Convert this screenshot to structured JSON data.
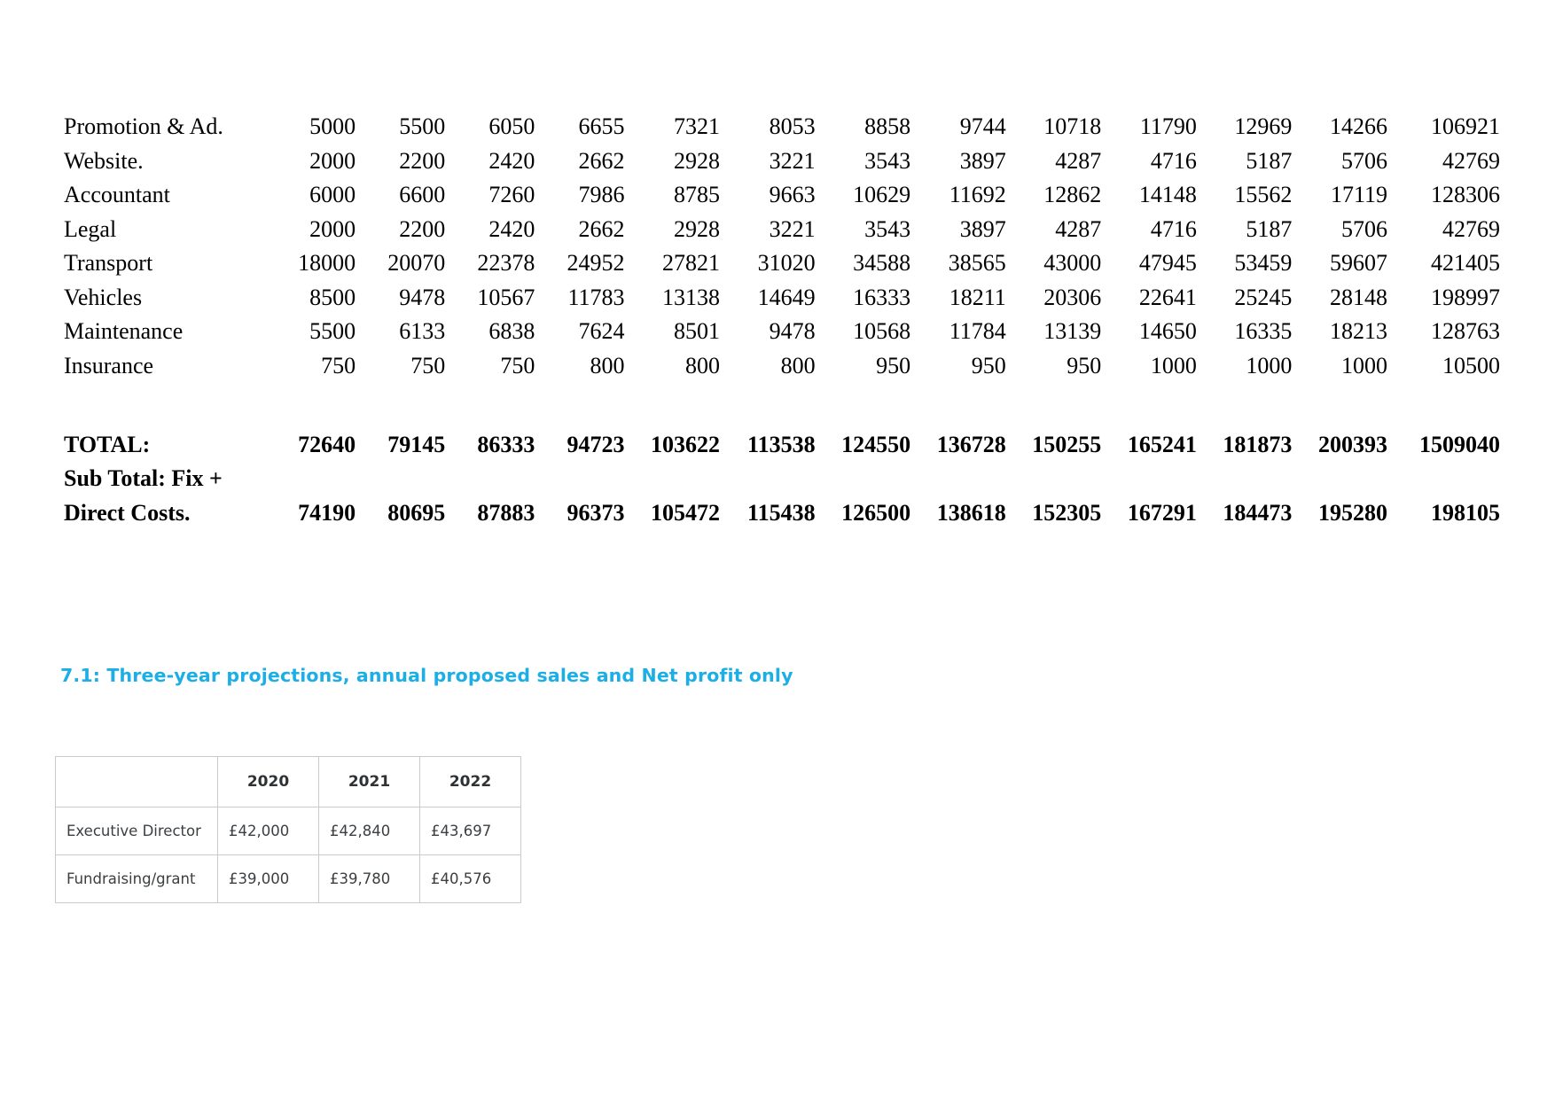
{
  "cost_table": {
    "rows": [
      {
        "label": "Promotion & Ad.",
        "values": [
          "5000",
          "5500",
          "6050",
          "6655",
          "7321",
          "8053",
          "8858",
          "9744",
          "10718",
          "11790",
          "12969",
          "14266",
          "106921"
        ]
      },
      {
        "label": "Website.",
        "values": [
          "2000",
          "2200",
          "2420",
          "2662",
          "2928",
          "3221",
          "3543",
          "3897",
          "4287",
          "4716",
          "5187",
          "5706",
          "42769"
        ]
      },
      {
        "label": "Accountant",
        "values": [
          "6000",
          "6600",
          "7260",
          "7986",
          "8785",
          "9663",
          "10629",
          "11692",
          "12862",
          "14148",
          "15562",
          "17119",
          "128306"
        ]
      },
      {
        "label": "Legal",
        "values": [
          "2000",
          "2200",
          "2420",
          "2662",
          "2928",
          "3221",
          "3543",
          "3897",
          "4287",
          "4716",
          "5187",
          "5706",
          "42769"
        ]
      },
      {
        "label": "Transport",
        "values": [
          "18000",
          "20070",
          "22378",
          "24952",
          "27821",
          "31020",
          "34588",
          "38565",
          "43000",
          "47945",
          "53459",
          "59607",
          "421405"
        ]
      },
      {
        "label": "Vehicles",
        "values": [
          "8500",
          "9478",
          "10567",
          "11783",
          "13138",
          "14649",
          "16333",
          "18211",
          "20306",
          "22641",
          "25245",
          "28148",
          "198997"
        ]
      },
      {
        "label": "Maintenance",
        "values": [
          "5500",
          "6133",
          "6838",
          "7624",
          "8501",
          "9478",
          "10568",
          "11784",
          "13139",
          "14650",
          "16335",
          "18213",
          "128763"
        ]
      },
      {
        "label": "Insurance",
        "values": [
          "750",
          "750",
          "750",
          "800",
          "800",
          "800",
          "950",
          "950",
          "950",
          "1000",
          "1000",
          "1000",
          "10500"
        ]
      }
    ],
    "total_row": {
      "label": "TOTAL:",
      "values": [
        "72640",
        "79145",
        "86333",
        "94723",
        "103622",
        "113538",
        "124550",
        "136728",
        "150255",
        "165241",
        "181873",
        "200393",
        "1509040"
      ]
    },
    "subtotal_label_line1": "Sub Total: Fix +",
    "subtotal_row": {
      "label": "Direct Costs.",
      "values": [
        "74190",
        "80695",
        "87883",
        "96373",
        "105472",
        "115438",
        "126500",
        "138618",
        "152305",
        "167291",
        "184473",
        "195280",
        "198105"
      ]
    }
  },
  "section": {
    "heading": "7.1: Three-year projections, annual proposed sales and Net profit only",
    "heading_color": "#1CAEE4"
  },
  "projection_table": {
    "corner": "",
    "year_headers": [
      "2020",
      "2021",
      "2022"
    ],
    "rows": [
      {
        "label": "Executive Director",
        "values": [
          "£42,000",
          "£42,840",
          "£43,697"
        ]
      },
      {
        "label": "Fundraising/grant",
        "values": [
          "£39,000",
          "£39,780",
          "£40,576"
        ]
      }
    ]
  }
}
